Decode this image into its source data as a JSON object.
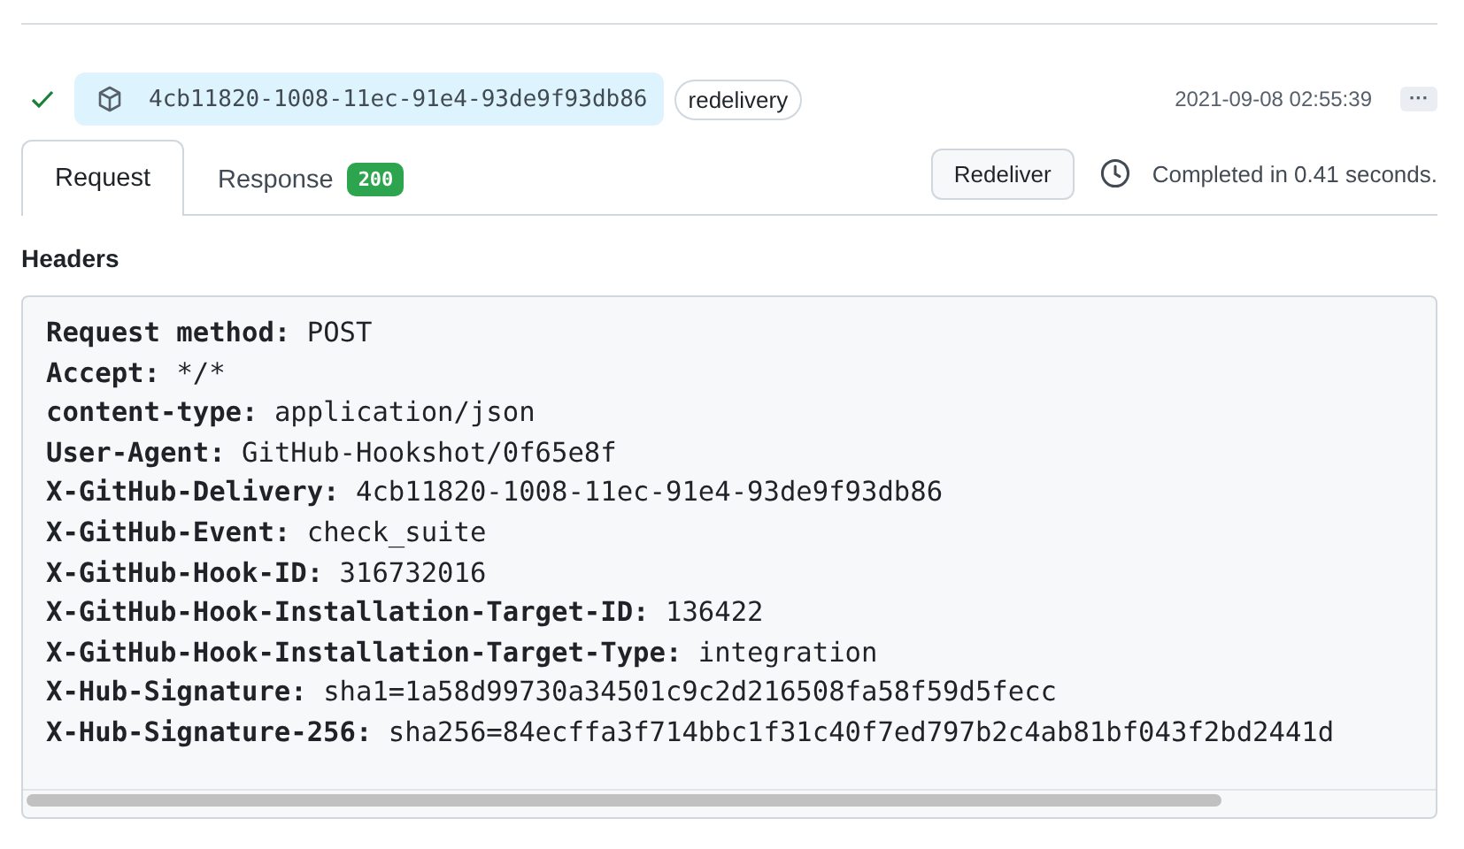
{
  "delivery": {
    "succeeded": true,
    "guid": "4cb11820-1008-11ec-91e4-93de9f93db86",
    "tag": "redelivery",
    "timestamp": "2021-09-08 02:55:39",
    "more": "···"
  },
  "tabs": [
    {
      "label": "Request",
      "selected": true
    },
    {
      "label": "Response",
      "selected": false,
      "badge": "200"
    }
  ],
  "redeliver_button": "Redeliver",
  "status": "Completed in 0.41 seconds.",
  "section_title": "Headers",
  "headers": [
    {
      "name": "Request method:",
      "value": "POST"
    },
    {
      "name": "Accept:",
      "value": "*/*"
    },
    {
      "name": "content-type:",
      "value": "application/json"
    },
    {
      "name": "User-Agent:",
      "value": "GitHub-Hookshot/0f65e8f"
    },
    {
      "name": "X-GitHub-Delivery:",
      "value": "4cb11820-1008-11ec-91e4-93de9f93db86"
    },
    {
      "name": "X-GitHub-Event:",
      "value": "check_suite"
    },
    {
      "name": "X-GitHub-Hook-ID:",
      "value": "316732016"
    },
    {
      "name": "X-GitHub-Hook-Installation-Target-ID:",
      "value": "136422"
    },
    {
      "name": "X-GitHub-Hook-Installation-Target-Type:",
      "value": "integration"
    },
    {
      "name": "X-Hub-Signature:",
      "value": "sha1=1a58d99730a34501c9c2d216508fa58f59d5fecc"
    },
    {
      "name": "X-Hub-Signature-256:",
      "value": "sha256=84ecffa3f714bbc1f31c40f7ed797b2c4ab81bf043f2bd2441d"
    }
  ]
}
